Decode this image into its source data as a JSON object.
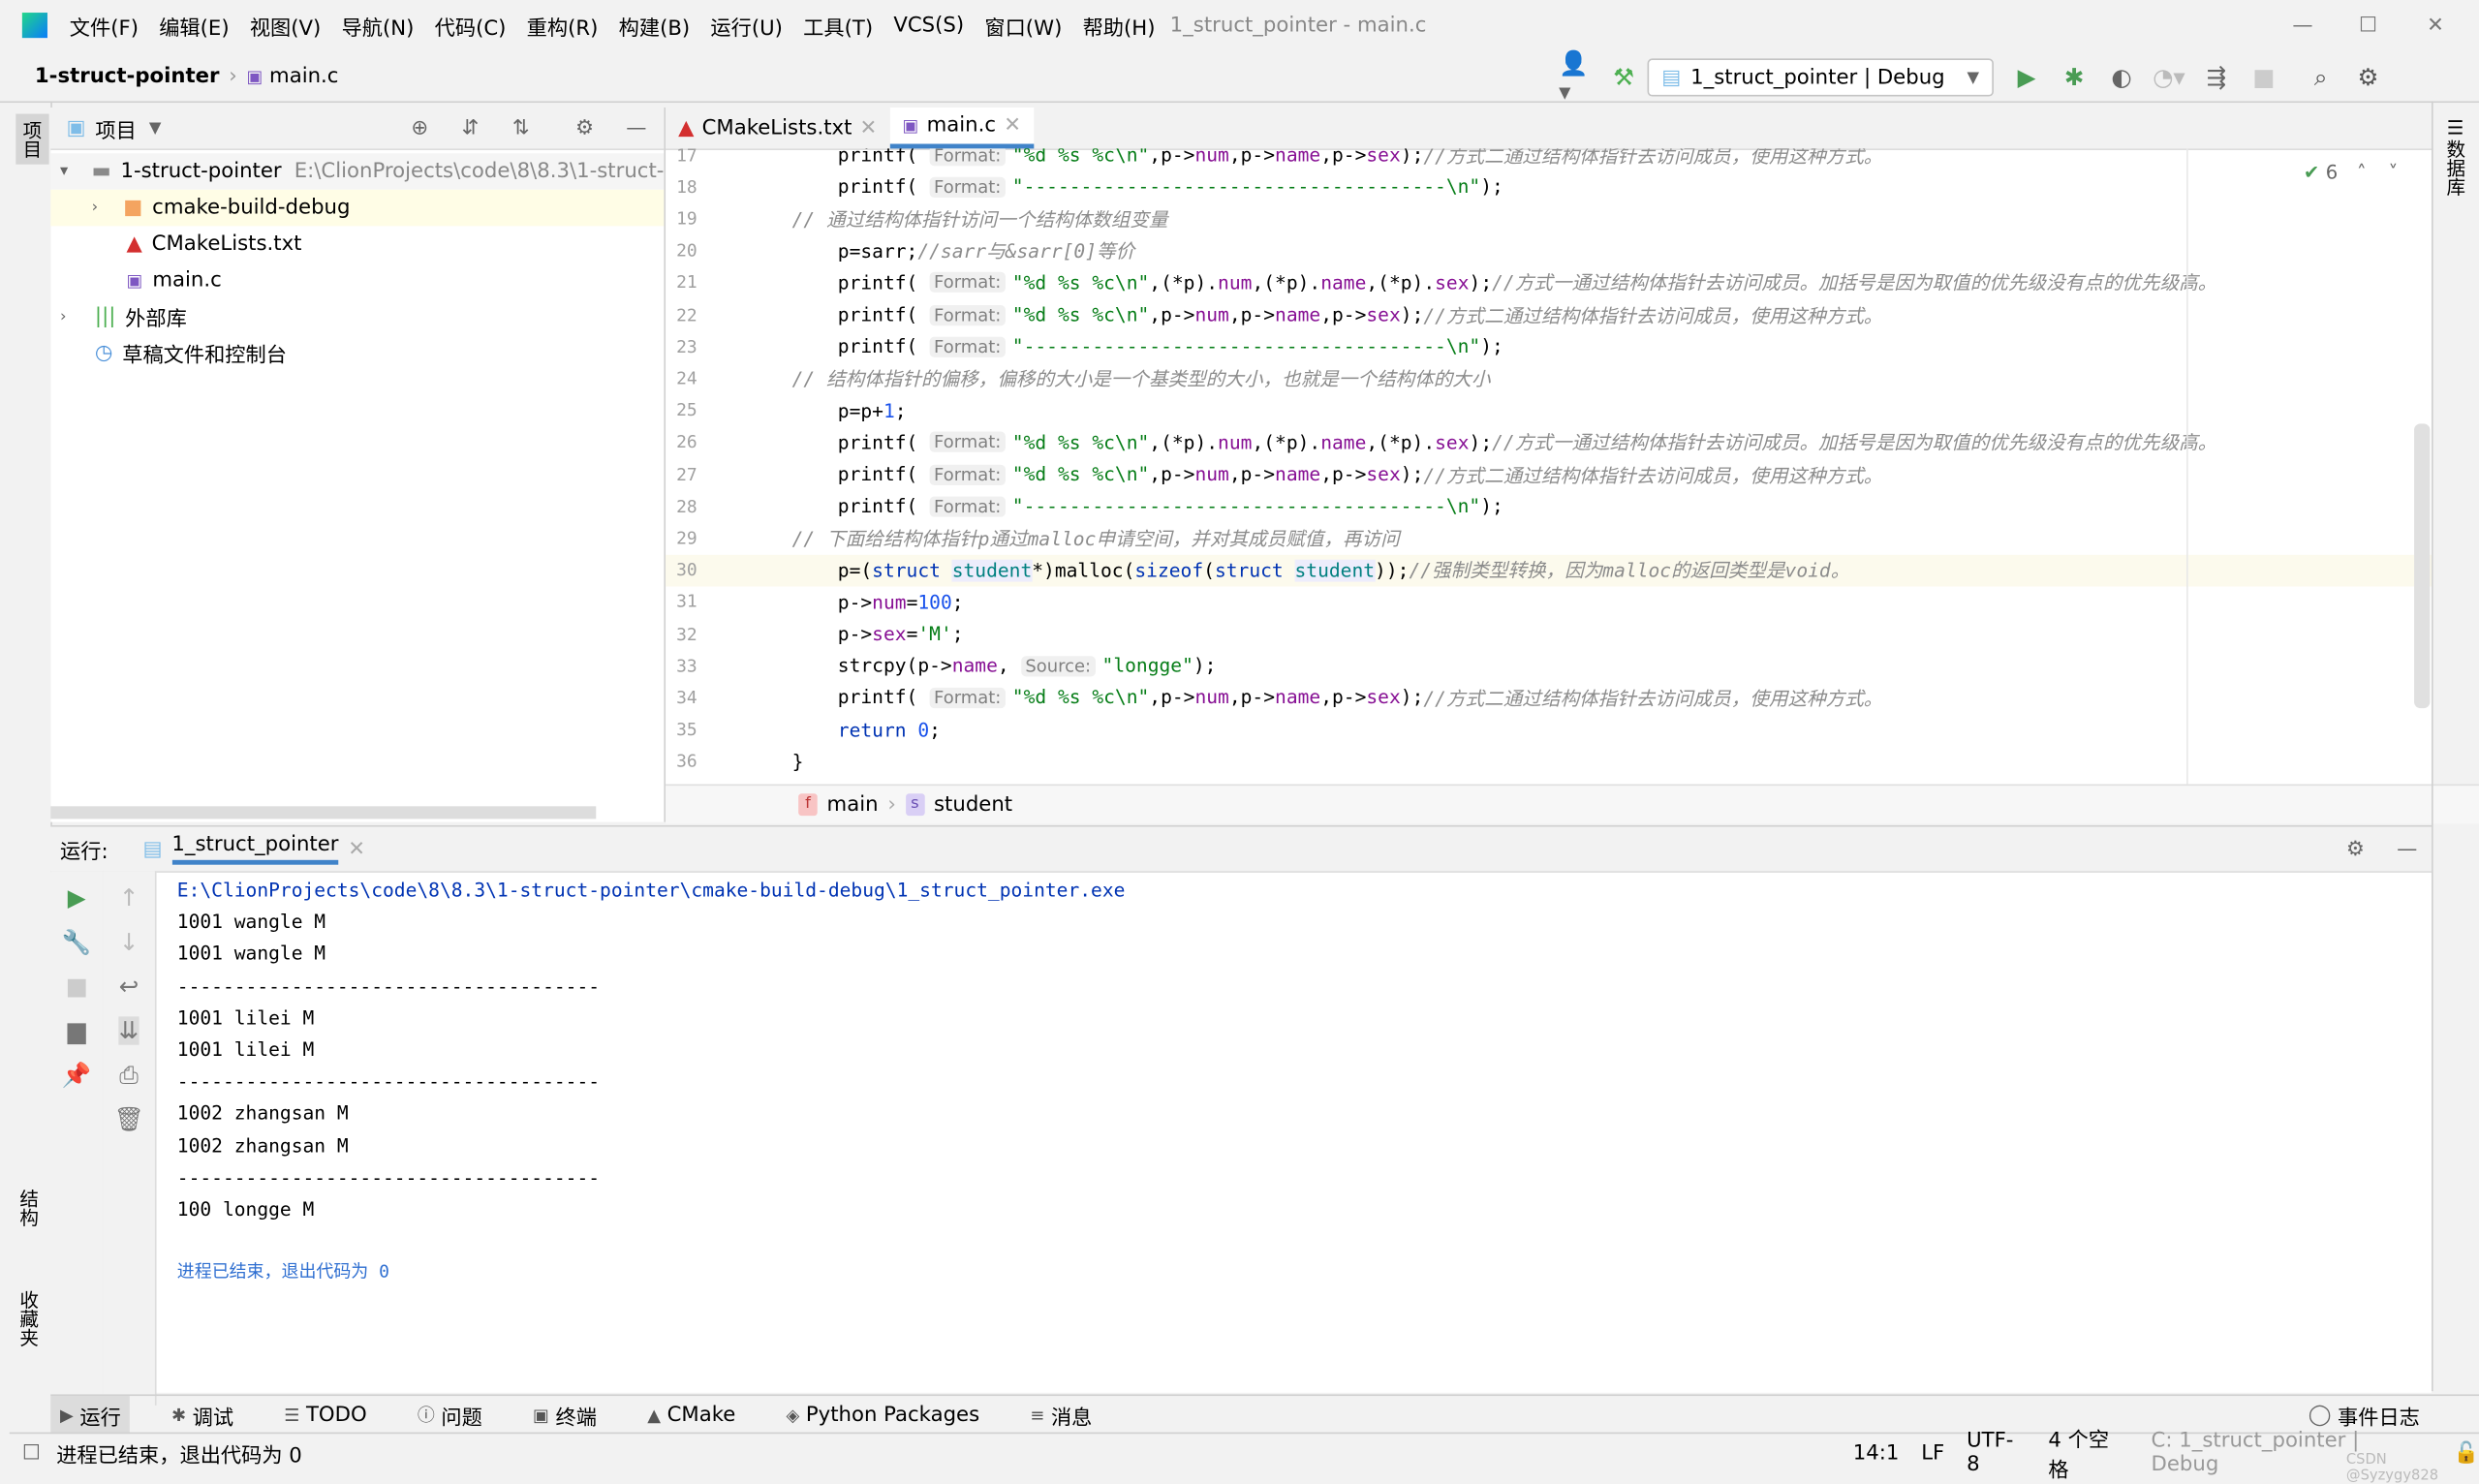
{
  "titlebar": {
    "menus": [
      "文件(F)",
      "编辑(E)",
      "视图(V)",
      "导航(N)",
      "代码(C)",
      "重构(R)",
      "构建(B)",
      "运行(U)",
      "工具(T)",
      "VCS(S)",
      "窗口(W)",
      "帮助(H)"
    ],
    "title": "1_struct_pointer - main.c"
  },
  "navbar": {
    "project": "1-struct-pointer",
    "file": "main.c",
    "run_config": "1_struct_pointer | Debug"
  },
  "leftstrip": {
    "project": "项目",
    "structure": "结构",
    "favorites": "收藏夹"
  },
  "rightstrip": {
    "database": "数据库"
  },
  "project": {
    "header": "项目",
    "items": [
      {
        "label": "1-struct-pointer",
        "path": "E:\\ClionProjects\\code\\8\\8.3\\1-struct-"
      },
      {
        "label": "cmake-build-debug"
      },
      {
        "label": "CMakeLists.txt"
      },
      {
        "label": "main.c"
      },
      {
        "label": "外部库"
      },
      {
        "label": "草稿文件和控制台"
      }
    ]
  },
  "editor": {
    "tabs": [
      {
        "label": "CMakeLists.txt"
      },
      {
        "label": "main.c",
        "active": true
      }
    ],
    "inspection_count": "6",
    "lines": [
      {
        "n": "17",
        "segs": [
          [
            "",
            "    printf( "
          ],
          [
            "hint",
            "Format:"
          ],
          [
            "str",
            "\"%d %s %c\\n\""
          ],
          [
            "",
            ",p->"
          ],
          [
            "field",
            "num"
          ],
          [
            "",
            ",p->"
          ],
          [
            "field",
            "name"
          ],
          [
            "",
            ",p->"
          ],
          [
            "field",
            "sex"
          ],
          [
            "",
            ");"
          ],
          [
            "cm",
            "//方式二通过结构体指针去访问成员，使用这种方式。"
          ]
        ]
      },
      {
        "n": "18",
        "segs": [
          [
            "",
            "    printf( "
          ],
          [
            "hint",
            "Format:"
          ],
          [
            "str",
            "\"-------------------------------------\\n\""
          ],
          [
            "",
            ");"
          ]
        ]
      },
      {
        "n": "19",
        "segs": [
          [
            "cm",
            "// 通过结构体指针访问一个结构体数组变量"
          ]
        ]
      },
      {
        "n": "20",
        "segs": [
          [
            "",
            "    p=sarr;"
          ],
          [
            "cm",
            "//sarr与&sarr[0]等价"
          ]
        ]
      },
      {
        "n": "21",
        "segs": [
          [
            "",
            "    printf( "
          ],
          [
            "hint",
            "Format:"
          ],
          [
            "str",
            "\"%d %s %c\\n\""
          ],
          [
            "",
            ",(*p)."
          ],
          [
            "field",
            "num"
          ],
          [
            "",
            ",(*p)."
          ],
          [
            "field",
            "name"
          ],
          [
            "",
            ",(*p)."
          ],
          [
            "field",
            "sex"
          ],
          [
            "",
            ");"
          ],
          [
            "cm",
            "//方式一通过结构体指针去访问成员。加括号是因为取值的优先级没有点的优先级高。"
          ]
        ]
      },
      {
        "n": "22",
        "segs": [
          [
            "",
            "    printf( "
          ],
          [
            "hint",
            "Format:"
          ],
          [
            "str",
            "\"%d %s %c\\n\""
          ],
          [
            "",
            ",p->"
          ],
          [
            "field",
            "num"
          ],
          [
            "",
            ",p->"
          ],
          [
            "field",
            "name"
          ],
          [
            "",
            ",p->"
          ],
          [
            "field",
            "sex"
          ],
          [
            "",
            ");"
          ],
          [
            "cm",
            "//方式二通过结构体指针去访问成员，使用这种方式。"
          ]
        ]
      },
      {
        "n": "23",
        "segs": [
          [
            "",
            "    printf( "
          ],
          [
            "hint",
            "Format:"
          ],
          [
            "str",
            "\"-------------------------------------\\n\""
          ],
          [
            "",
            ");"
          ]
        ]
      },
      {
        "n": "24",
        "segs": [
          [
            "cm",
            "// 结构体指针的偏移，偏移的大小是一个基类型的大小，也就是一个结构体的大小"
          ]
        ]
      },
      {
        "n": "25",
        "segs": [
          [
            "",
            "    p=p+"
          ],
          [
            "num",
            "1"
          ],
          [
            "",
            ";"
          ]
        ]
      },
      {
        "n": "26",
        "segs": [
          [
            "",
            "    printf( "
          ],
          [
            "hint",
            "Format:"
          ],
          [
            "str",
            "\"%d %s %c\\n\""
          ],
          [
            "",
            ",(*p)."
          ],
          [
            "field",
            "num"
          ],
          [
            "",
            ",(*p)."
          ],
          [
            "field",
            "name"
          ],
          [
            "",
            ",(*p)."
          ],
          [
            "field",
            "sex"
          ],
          [
            "",
            ");"
          ],
          [
            "cm",
            "//方式一通过结构体指针去访问成员。加括号是因为取值的优先级没有点的优先级高。"
          ]
        ]
      },
      {
        "n": "27",
        "segs": [
          [
            "",
            "    printf( "
          ],
          [
            "hint",
            "Format:"
          ],
          [
            "str",
            "\"%d %s %c\\n\""
          ],
          [
            "",
            ",p->"
          ],
          [
            "field",
            "num"
          ],
          [
            "",
            ",p->"
          ],
          [
            "field",
            "name"
          ],
          [
            "",
            ",p->"
          ],
          [
            "field",
            "sex"
          ],
          [
            "",
            ");"
          ],
          [
            "cm",
            "//方式二通过结构体指针去访问成员，使用这种方式。"
          ]
        ]
      },
      {
        "n": "28",
        "segs": [
          [
            "",
            "    printf( "
          ],
          [
            "hint",
            "Format:"
          ],
          [
            "str",
            "\"-------------------------------------\\n\""
          ],
          [
            "",
            ");"
          ]
        ]
      },
      {
        "n": "29",
        "segs": [
          [
            "cm",
            "// 下面给结构体指针p通过malloc申请空间，并对其成员赋值，再访问"
          ]
        ]
      },
      {
        "n": "30",
        "current": true,
        "segs": [
          [
            "",
            "    p=("
          ],
          [
            "kw",
            "struct "
          ],
          [
            "ty",
            "student"
          ],
          [
            "",
            "*)malloc("
          ],
          [
            "kw",
            "sizeof"
          ],
          [
            "",
            "("
          ],
          [
            "kw",
            "struct "
          ],
          [
            "ty",
            "student"
          ],
          [
            "",
            "));"
          ],
          [
            "cm",
            "//强制类型转换，因为malloc的返回类型是void。"
          ]
        ]
      },
      {
        "n": "31",
        "segs": [
          [
            "",
            "    p->"
          ],
          [
            "field",
            "num"
          ],
          [
            "",
            "="
          ],
          [
            "num",
            "100"
          ],
          [
            "",
            ";"
          ]
        ]
      },
      {
        "n": "32",
        "segs": [
          [
            "",
            "    p->"
          ],
          [
            "field",
            "sex"
          ],
          [
            "",
            "="
          ],
          [
            "str",
            "'M'"
          ],
          [
            "",
            ";"
          ]
        ]
      },
      {
        "n": "33",
        "segs": [
          [
            "",
            "    strcpy(p->"
          ],
          [
            "field",
            "name"
          ],
          [
            "",
            ", "
          ],
          [
            "hint",
            "Source:"
          ],
          [
            "str",
            "\"longge\""
          ],
          [
            "",
            ");"
          ]
        ]
      },
      {
        "n": "34",
        "segs": [
          [
            "",
            "    printf( "
          ],
          [
            "hint",
            "Format:"
          ],
          [
            "str",
            "\"%d %s %c\\n\""
          ],
          [
            "",
            ",p->"
          ],
          [
            "field",
            "num"
          ],
          [
            "",
            ",p->"
          ],
          [
            "field",
            "name"
          ],
          [
            "",
            ",p->"
          ],
          [
            "field",
            "sex"
          ],
          [
            "",
            ");"
          ],
          [
            "cm",
            "//方式二通过结构体指针去访问成员，使用这种方式。"
          ]
        ]
      },
      {
        "n": "35",
        "segs": [
          [
            "kw",
            "    return "
          ],
          [
            "num",
            "0"
          ],
          [
            "",
            ";"
          ]
        ]
      },
      {
        "n": "36",
        "segs": [
          [
            "",
            "}"
          ]
        ]
      }
    ],
    "breadcrumb": [
      {
        "badge": "f",
        "label": "main"
      },
      {
        "badge": "s",
        "label": "student"
      }
    ]
  },
  "run": {
    "label": "运行:",
    "tab": "1_struct_pointer",
    "output": [
      "E:\\ClionProjects\\code\\8\\8.3\\1-struct-pointer\\cmake-build-debug\\1_struct_pointer.exe",
      "1001 wangle M",
      "1001 wangle M",
      "-------------------------------------",
      "1001 lilei M",
      "1001 lilei M",
      "-------------------------------------",
      "1002 zhangsan M",
      "1002 zhangsan M",
      "-------------------------------------",
      "100 longge M",
      "",
      "进程已结束，退出代码为 0"
    ]
  },
  "bottomtabs": [
    {
      "icon": "play-icon",
      "label": "运行"
    },
    {
      "icon": "bug-icon",
      "label": "调试"
    },
    {
      "icon": "list-icon",
      "label": "TODO"
    },
    {
      "icon": "info-icon",
      "label": "问题"
    },
    {
      "icon": "terminal-icon",
      "label": "终端"
    },
    {
      "icon": "cmake-icon",
      "label": "CMake"
    },
    {
      "icon": "package-icon",
      "label": "Python Packages"
    },
    {
      "icon": "message-icon",
      "label": "消息"
    }
  ],
  "event_log": "事件日志",
  "status": {
    "message": "进程已结束，退出代码为 0",
    "position": "14:1",
    "line_sep": "LF",
    "encoding": "UTF-8",
    "indent": "4 个空格",
    "context": "C: 1_struct_pointer | Debug"
  },
  "watermark": "CSDN @Syzygy828"
}
